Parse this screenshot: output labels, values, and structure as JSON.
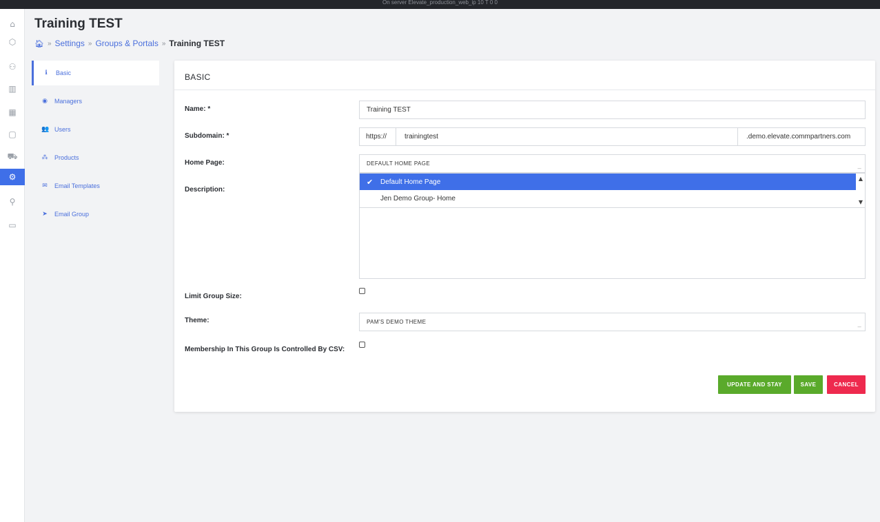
{
  "topbar": {
    "text": "On server Elevate_production_web_ip 10 T 0 0"
  },
  "rail": {
    "icons": [
      "home-icon",
      "package-icon",
      "users-icon",
      "book-icon",
      "grid-icon",
      "box-icon",
      "cart-icon",
      "settings-icon",
      "bulb-icon",
      "monitor-icon"
    ],
    "active": "settings-icon",
    "accent": "#3f6fe8"
  },
  "page": {
    "title": "Training TEST"
  },
  "breadcrumb": {
    "home_icon": "home-icon",
    "items": [
      "Settings",
      "Groups & Portals"
    ],
    "current": "Training TEST",
    "sep": "»"
  },
  "sidenav": {
    "items": [
      {
        "label": "Basic",
        "icon": "info-icon",
        "glyph": "ℹ"
      },
      {
        "label": "Managers",
        "icon": "user-circle-icon",
        "glyph": "◉"
      },
      {
        "label": "Users",
        "icon": "users-icon",
        "glyph": "👥"
      },
      {
        "label": "Products",
        "icon": "products-icon",
        "glyph": "⁂"
      },
      {
        "label": "Email Templates",
        "icon": "envelope-icon",
        "glyph": "✉"
      },
      {
        "label": "Email Group",
        "icon": "paper-plane-icon",
        "glyph": "➤"
      }
    ]
  },
  "form": {
    "header": "BASIC",
    "name_label": "Name: *",
    "name_value": "Training TEST",
    "subdomain_label": "Subdomain: *",
    "subdomain_prefix": "https://",
    "subdomain_value": "trainingtest",
    "subdomain_suffix": ".demo.elevate.commpartners.com",
    "homepage_label": "Home Page:",
    "homepage_value": "DEFAULT HOME PAGE",
    "homepage_options": [
      "Default Home Page",
      "Jen Demo Group- Home"
    ],
    "description_label": "Description:",
    "limit_label": "Limit Group Size:",
    "limit_checked": false,
    "theme_label": "Theme:",
    "theme_value": "PAM'S DEMO THEME",
    "csv_label": "Membership In This Group Is Controlled By CSV:",
    "csv_checked": false
  },
  "buttons": {
    "update": "UPDATE AND STAY",
    "save": "SAVE",
    "cancel": "CANCEL"
  },
  "colors": {
    "green": "#5aaa2b",
    "red": "#ee2a4e",
    "link": "#4a6fdc"
  }
}
